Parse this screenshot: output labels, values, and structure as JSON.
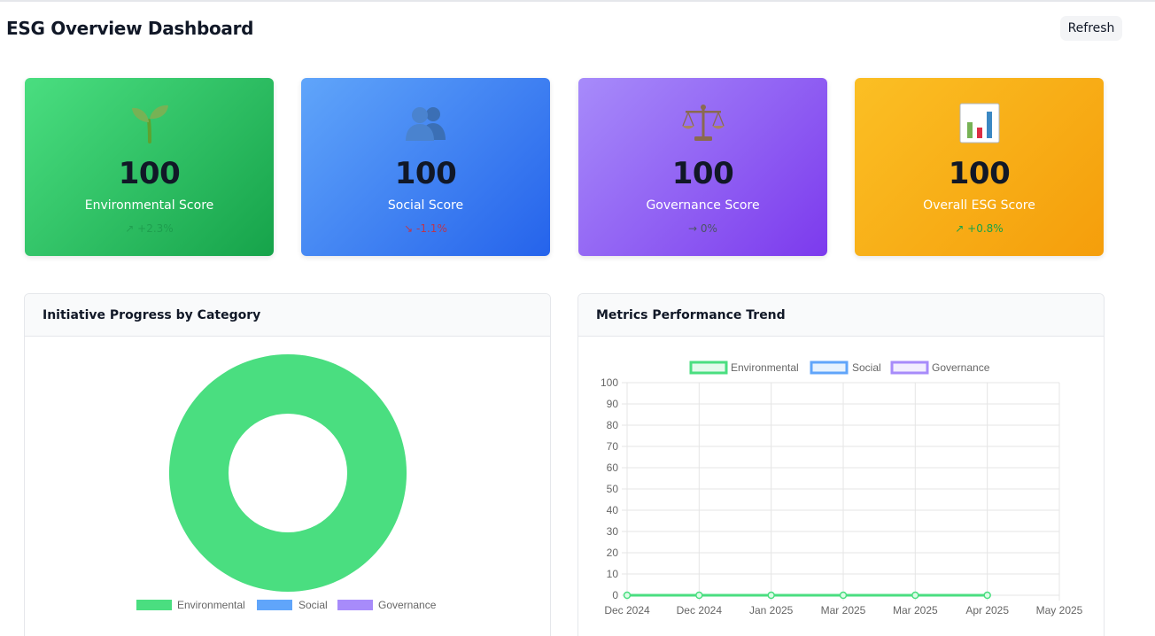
{
  "header": {
    "title": "ESG Overview Dashboard",
    "refresh_label": "Refresh"
  },
  "cards": [
    {
      "icon": "seedling-icon",
      "value": "100",
      "label": "Environmental Score",
      "change": "↗ +2.3%",
      "trend": "up"
    },
    {
      "icon": "people-icon",
      "value": "100",
      "label": "Social Score",
      "change": "↘ -1.1%",
      "trend": "down"
    },
    {
      "icon": "scales-icon",
      "value": "100",
      "label": "Governance Score",
      "change": "→ 0%",
      "trend": "flat"
    },
    {
      "icon": "bar-chart-icon",
      "value": "100",
      "label": "Overall ESG Score",
      "change": "↗ +0.8%",
      "trend": "up"
    }
  ],
  "colors": {
    "environmental": "#4ade80",
    "social": "#60a5fa",
    "governance": "#a78bfa",
    "overall": "#fbbf24"
  },
  "panels": {
    "initiative_title": "Initiative Progress by Category",
    "metrics_title": "Metrics Performance Trend"
  },
  "chart_data": [
    {
      "type": "pie",
      "title": "Initiative Progress by Category",
      "variant": "doughnut",
      "categories": [
        "Environmental",
        "Social",
        "Governance"
      ],
      "values": [
        100,
        0,
        0
      ],
      "legend": "bottom"
    },
    {
      "type": "line",
      "title": "Metrics Performance Trend",
      "x": [
        "Dec 2024",
        "Dec 2024",
        "Jan 2025",
        "Mar 2025",
        "Mar 2025",
        "Apr 2025",
        "May 2025"
      ],
      "series": [
        {
          "name": "Environmental",
          "values": [
            0,
            0,
            0,
            0,
            0,
            0
          ]
        },
        {
          "name": "Social",
          "values": []
        },
        {
          "name": "Governance",
          "values": []
        }
      ],
      "ylim": [
        0,
        100
      ],
      "yticks": [
        0,
        10,
        20,
        30,
        40,
        50,
        60,
        70,
        80,
        90,
        100
      ],
      "grid": true,
      "legend": "top"
    }
  ]
}
